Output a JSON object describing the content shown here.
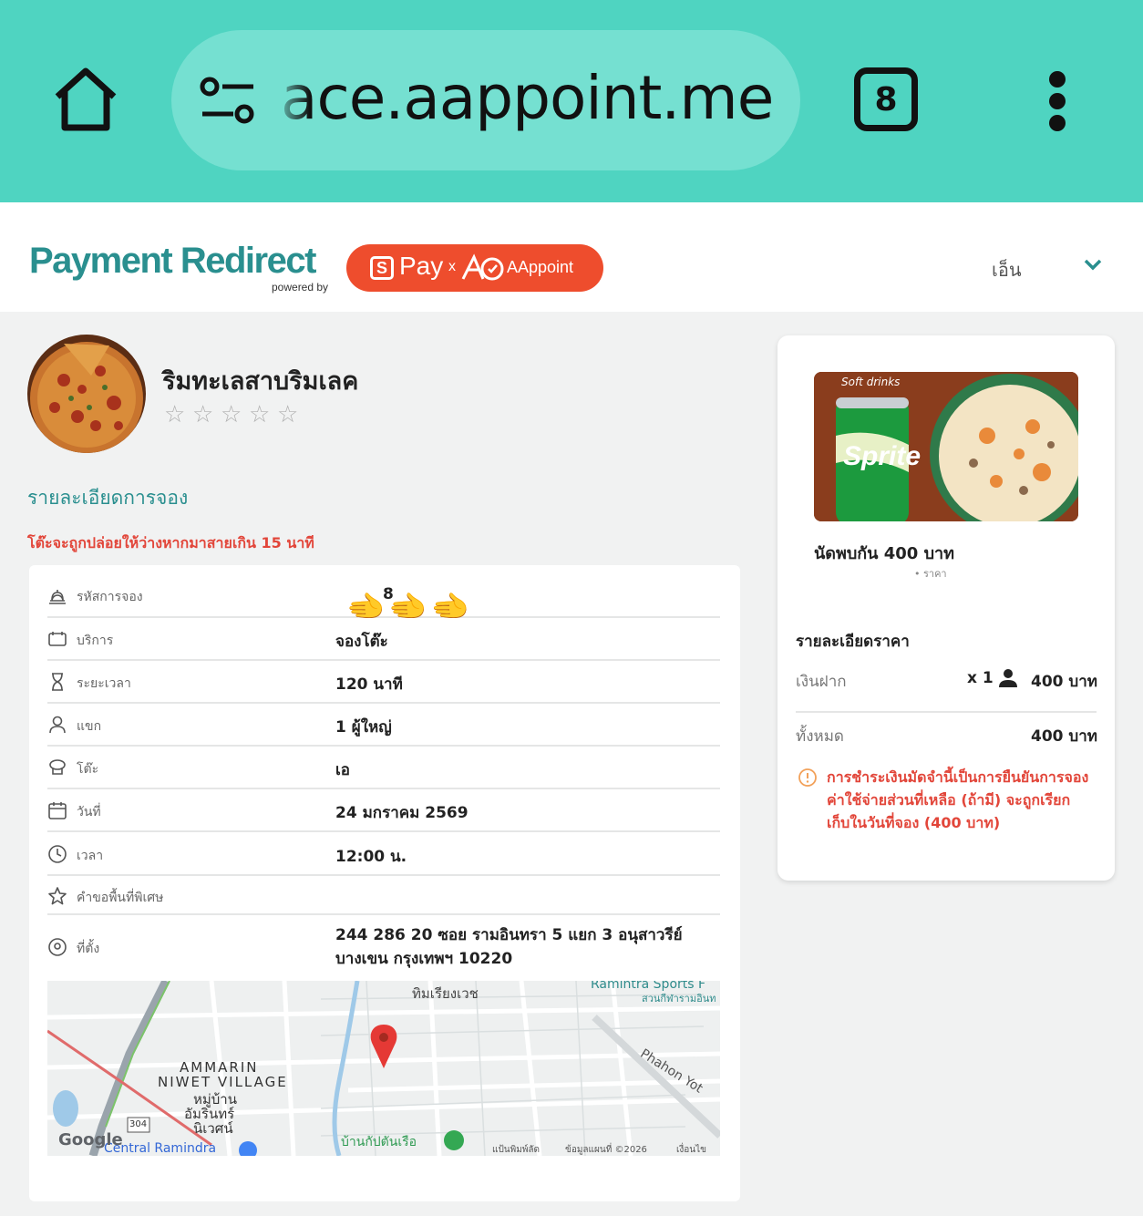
{
  "browser": {
    "url": "ace.aappoint.me",
    "tab_count": "8"
  },
  "header": {
    "brand_title": "Payment Redirect",
    "powered_by": "powered by",
    "partner": {
      "spay_text": "Pay",
      "x_text": "x",
      "aappoint_text": "AAppoint"
    },
    "language": "เอ็น"
  },
  "restaurant": {
    "name": "ริมทะเลสาบริมเลค",
    "rating_stars": 5,
    "filled_stars": 0
  },
  "booking": {
    "section_title": "รายละเอียดการจอง",
    "warning": "โต๊ะจะถูกปล่อยให้ว่างหากมาสายเกิน 15 นาที",
    "rows": [
      {
        "label": "รหัสการจอง",
        "value": "8"
      },
      {
        "label": "บริการ",
        "value": "จองโต๊ะ"
      },
      {
        "label": "ระยะเวลา",
        "value": "120 นาที"
      },
      {
        "label": "แขก",
        "value": "1 ผู้ใหญ่"
      },
      {
        "label": "โต๊ะ",
        "value": "เอ"
      },
      {
        "label": "วันที่",
        "value": "24 มกราคม 2569"
      },
      {
        "label": "เวลา",
        "value": "12:00 น."
      },
      {
        "label": "คำขอพื้นที่พิเศษ",
        "value": ""
      },
      {
        "label": "ที่ตั้ง",
        "value_line1": "244 286 20 ซอย รามอินทรา 5 แยก 3 อนุสาวรีย์",
        "value_line2": "บางเขน กรุงเทพฯ 10220"
      }
    ],
    "code_emoji": "🫲🫲🫲"
  },
  "map": {
    "labels": {
      "ammarin": "AMMARIN",
      "niwet": "NIWET VILLAGE",
      "moo_ban": "หมู่บ้าน",
      "ammarin_th": "อัมรินทร์",
      "niwet_th": "นิเวศน์",
      "ramintra_sports": "Ramintra Sports F",
      "ramintra_sports_th": "สวนกีฬารามอินท",
      "phahon": "Phahon Yot",
      "central": "Central Ramindra",
      "top_th": "ทิมเรียงเวช",
      "bottom_th": "บ้านกัปตันเรือ",
      "route": "304",
      "google": "Google",
      "shortcuts": "แป้นพิมพ์ลัด",
      "mapdata": "ข้อมูลแผนที่ ©2026",
      "terms": "เงื่อนไข"
    }
  },
  "side": {
    "promo_banner_text": "Soft drinks",
    "promo_can_text": "Sprite",
    "promo_name": "นัดพบกัน  400 บาท",
    "promo_sub": "• ราคา",
    "price_title": "รายละเอียดราคา",
    "deposit_label": "เงินฝาก",
    "deposit_qty": "x 1",
    "deposit_amount": "400 บาท",
    "total_label": "ทั้งหมด",
    "total_amount": "400 บาท",
    "notice": "การชำระเงินมัดจำนี้เป็นการยืนยันการจอง ค่าใช้จ่ายส่วนที่เหลือ (ถ้ามี) จะถูกเรียกเก็บในวันที่จอง (400 บาท)"
  },
  "colors": {
    "browser_bar": "#4fd4c1",
    "brand_teal": "#2a8f8f",
    "shopee_orange": "#ee4d2d",
    "warning_red": "#e2463a"
  }
}
